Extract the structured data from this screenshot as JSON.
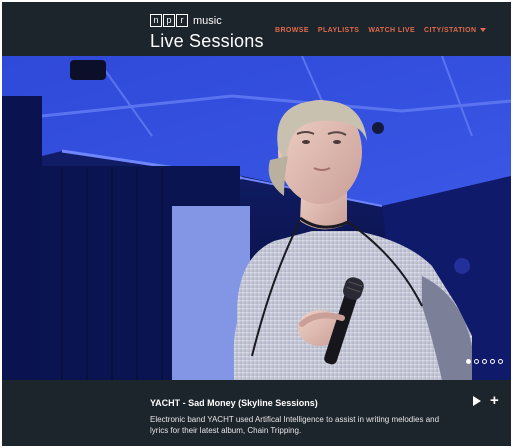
{
  "brand": {
    "npr_letters": [
      "n",
      "p",
      "r"
    ],
    "music_label": "music",
    "title": "Live Sessions"
  },
  "nav": {
    "items": [
      {
        "label": "BROWSE"
      },
      {
        "label": "PLAYLISTS"
      },
      {
        "label": "WATCH LIVE"
      }
    ],
    "city_label": "CITY",
    "slash": "/",
    "station_label": "STATION"
  },
  "hero": {
    "image_subject": "singer-with-microphone",
    "slide_count": 5,
    "active_slide": 1
  },
  "caption": {
    "title": "YACHT - Sad Money (Skyline Sessions)",
    "description": "Electronic band YACHT used Artifical Intelligence to assist in writing melodies and lyrics for their latest album, Chain Tripping."
  },
  "colors": {
    "background": "#1c242c",
    "nav_accent": "#e06a4a",
    "text": "#ffffff"
  },
  "icons": {
    "play": "play-icon",
    "add": "plus-icon",
    "dropdown": "caret-down-icon"
  }
}
